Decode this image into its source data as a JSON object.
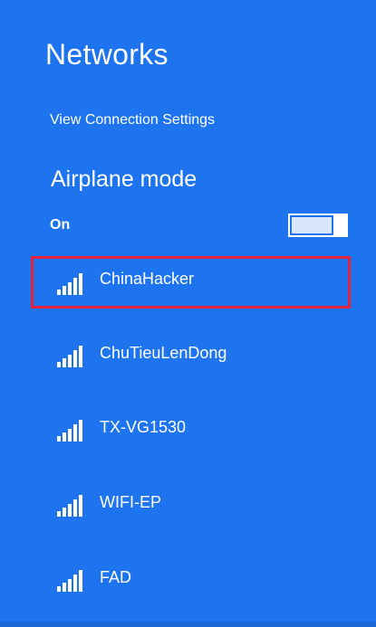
{
  "header": {
    "title": "Networks",
    "view_settings_label": "View Connection Settings"
  },
  "airplane": {
    "title": "Airplane mode",
    "state_label": "On"
  },
  "networks": [
    {
      "ssid": "ChinaHacker",
      "signal_icon": "wifi-signal-icon",
      "selected": true
    },
    {
      "ssid": "ChuTieuLenDong",
      "signal_icon": "wifi-signal-icon",
      "selected": false
    },
    {
      "ssid": "TX-VG1530",
      "signal_icon": "wifi-signal-icon",
      "selected": false
    },
    {
      "ssid": "WIFI-EP",
      "signal_icon": "wifi-signal-icon",
      "selected": false
    },
    {
      "ssid": "FAD",
      "signal_icon": "wifi-signal-icon",
      "selected": false
    }
  ],
  "colors": {
    "background": "#1e74ee",
    "selection_border": "#e5233a",
    "text": "#ffffff"
  }
}
